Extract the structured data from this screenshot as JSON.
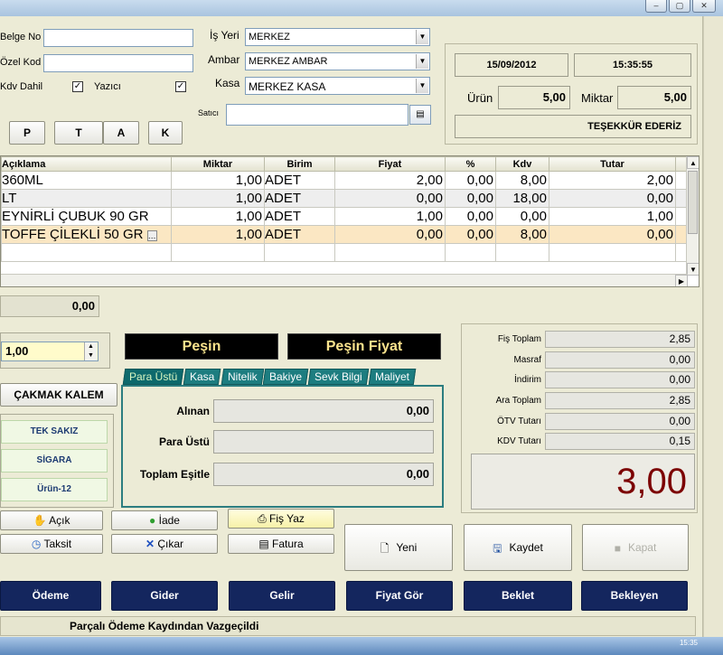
{
  "window": {
    "minimize_glyph": "–",
    "maximize_glyph": "▢",
    "close_glyph": "✕"
  },
  "form": {
    "belge_no_label": "Belge No",
    "belge_no_value": "",
    "ozel_kod_label": "Özel Kod",
    "ozel_kod_value": "",
    "kdv_dahil_label": "Kdv Dahil",
    "yazici_label": "Yazıcı",
    "is_yeri_label": "İş Yeri",
    "is_yeri_value": "MERKEZ",
    "ambar_label": "Ambar",
    "ambar_value": "MERKEZ AMBAR",
    "kasa_label": "Kasa",
    "kasa_value": "MERKEZ KASA",
    "satici_label": "Satıcı",
    "satici_value": "",
    "price_buttons": [
      "P",
      "T",
      "A",
      "K"
    ]
  },
  "info": {
    "date": "15/09/2012",
    "time": "15:35:55",
    "urun_label": "Ürün",
    "urun_value": "5,00",
    "miktar_label": "Miktar",
    "miktar_value": "5,00",
    "message": "TEŞEKKÜR EDERİZ"
  },
  "grid": {
    "columns": [
      "Açıklama",
      "Miktar",
      "Birim",
      "Fiyat",
      "%",
      "Kdv",
      "Tutar"
    ],
    "rows": [
      {
        "aciklama": "360ML",
        "miktar": "1,00",
        "birim": "ADET",
        "fiyat": "2,00",
        "yuzde": "0,00",
        "kdv": "8,00",
        "tutar": "2,00"
      },
      {
        "aciklama": "LT",
        "miktar": "1,00",
        "birim": "ADET",
        "fiyat": "0,00",
        "yuzde": "0,00",
        "kdv": "18,00",
        "tutar": "0,00"
      },
      {
        "aciklama": "EYNİRLİ ÇUBUK 90 GR",
        "miktar": "1,00",
        "birim": "ADET",
        "fiyat": "1,00",
        "yuzde": "0,00",
        "kdv": "0,00",
        "tutar": "1,00"
      },
      {
        "aciklama": "TOFFE ÇİLEKLİ 50 GR",
        "miktar": "1,00",
        "birim": "ADET",
        "fiyat": "0,00",
        "yuzde": "0,00",
        "kdv": "8,00",
        "tutar": "0,00"
      }
    ],
    "footer_total": "0,00"
  },
  "quantity": "1,00",
  "cakmak_label": "ÇAKMAK KALEM",
  "quick_items": [
    "TEK SAKIZ",
    "SİGARA",
    "Ürün-12"
  ],
  "payment_mode": "Peşin",
  "price_mode": "Peşin Fiyat",
  "tabs": [
    "Para Üstü",
    "Kasa",
    "Nitelik",
    "Bakiye",
    "Sevk Bilgi",
    "Maliyet"
  ],
  "payment": {
    "alinan_label": "Alınan",
    "alinan_value": "0,00",
    "para_ustu_label": "Para Üstü",
    "para_ustu_value": "",
    "toplam_esitle_label": "Toplam Eşitle",
    "toplam_esitle_value": "0,00"
  },
  "summary": {
    "fis_toplam_label": "Fiş Toplam",
    "fis_toplam": "2,85",
    "masraf_label": "Masraf",
    "masraf": "0,00",
    "indirim_label": "İndirim",
    "indirim": "0,00",
    "ara_toplam_label": "Ara Toplam",
    "ara_toplam": "2,85",
    "otv_label": "ÖTV Tutarı",
    "otv": "0,00",
    "kdv_label": "KDV Tutarı",
    "kdv": "0,15",
    "grand_total": "3,00"
  },
  "actions": {
    "acik": "Açık",
    "taksit": "Taksit",
    "iade": "İade",
    "cikar": "Çıkar",
    "fis_yaz": "Fiş Yaz",
    "fatura": "Fatura",
    "yeni": "Yeni",
    "kaydet": "Kaydet",
    "kapat": "Kapat"
  },
  "nav": [
    "Ödeme",
    "Gider",
    "Gelir",
    "Fiyat Gör",
    "Beklet",
    "Bekleyen"
  ],
  "status": "Parçalı Ödeme Kaydından Vazgeçildi",
  "taskbar_time": "15:35"
}
